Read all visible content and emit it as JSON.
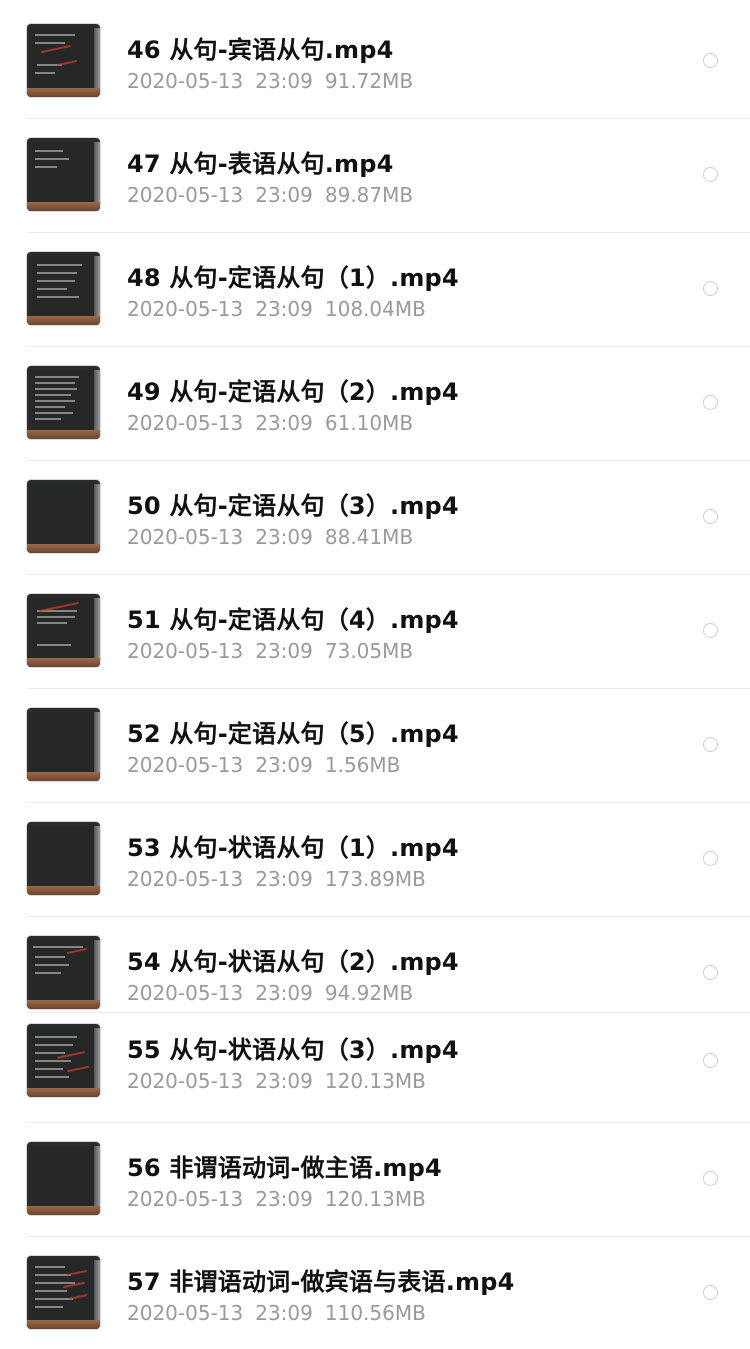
{
  "files": [
    {
      "name": "46 从句-宾语从句.mp4",
      "date": "2020-05-13",
      "time": "23:09",
      "size": "91.72MB",
      "thumb_icon": "video-thumbnail-blackboard"
    },
    {
      "name": "47 从句-表语从句.mp4",
      "date": "2020-05-13",
      "time": "23:09",
      "size": "89.87MB",
      "thumb_icon": "video-thumbnail-blackboard"
    },
    {
      "name": "48 从句-定语从句（1）.mp4",
      "date": "2020-05-13",
      "time": "23:09",
      "size": "108.04MB",
      "thumb_icon": "video-thumbnail-blackboard"
    },
    {
      "name": "49 从句-定语从句（2）.mp4",
      "date": "2020-05-13",
      "time": "23:09",
      "size": "61.10MB",
      "thumb_icon": "video-thumbnail-blackboard"
    },
    {
      "name": "50 从句-定语从句（3）.mp4",
      "date": "2020-05-13",
      "time": "23:09",
      "size": "88.41MB",
      "thumb_icon": "video-thumbnail-blackboard"
    },
    {
      "name": "51 从句-定语从句（4）.mp4",
      "date": "2020-05-13",
      "time": "23:09",
      "size": "73.05MB",
      "thumb_icon": "video-thumbnail-blackboard"
    },
    {
      "name": "52 从句-定语从句（5）.mp4",
      "date": "2020-05-13",
      "time": "23:09",
      "size": "1.56MB",
      "thumb_icon": "video-thumbnail-blackboard"
    },
    {
      "name": "53  从句-状语从句（1）.mp4",
      "date": "2020-05-13",
      "time": "23:09",
      "size": "173.89MB",
      "thumb_icon": "video-thumbnail-blackboard"
    },
    {
      "name": "54 从句-状语从句（2）.mp4",
      "date": "2020-05-13",
      "time": "23:09",
      "size": "94.92MB",
      "thumb_icon": "video-thumbnail-blackboard"
    },
    {
      "name": "55 从句-状语从句（3）.mp4",
      "date": "2020-05-13",
      "time": "23:09",
      "size": "120.13MB",
      "thumb_icon": "video-thumbnail-blackboard"
    },
    {
      "name": "56 非谓语动词-做主语.mp4",
      "date": "2020-05-13",
      "time": "23:09",
      "size": "120.13MB",
      "thumb_icon": "video-thumbnail-blackboard"
    },
    {
      "name": "57 非谓语动词-做宾语与表语.mp4",
      "date": "2020-05-13",
      "time": "23:09",
      "size": "110.56MB",
      "thumb_icon": "video-thumbnail-blackboard"
    }
  ],
  "colors": {
    "name_text": "#111111",
    "meta_text": "#9a9a9a",
    "divider": "#ececec",
    "radio_border": "#cfcfcf"
  }
}
